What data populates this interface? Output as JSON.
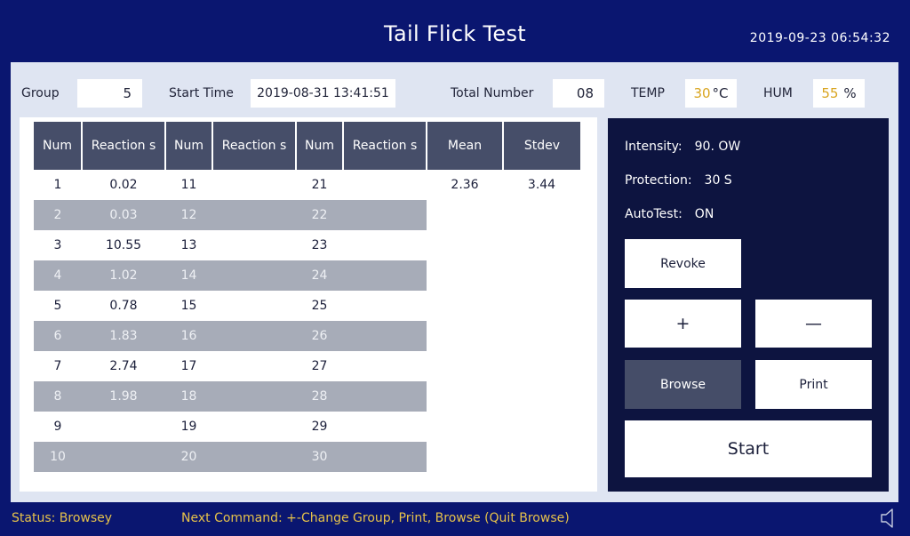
{
  "header": {
    "title": "Tail Flick Test",
    "datetime": "2019-09-23 06:54:32"
  },
  "info_bar": {
    "group_label": "Group",
    "group_value": "5",
    "start_time_label": "Start Time",
    "start_time_value": "2019-08-31 13:41:51",
    "total_number_label": "Total Number",
    "total_number_value": "08",
    "temp_label": "TEMP",
    "temp_value": "30",
    "temp_unit": "°C",
    "hum_label": "HUM",
    "hum_value": "55",
    "hum_unit": "%"
  },
  "table": {
    "headers": [
      "Num",
      "Reaction s",
      "Num",
      "Reaction s",
      "Num",
      "Reaction s",
      "Mean",
      "Stdev"
    ],
    "rows": [
      [
        "1",
        "0.02",
        "11",
        "",
        "21",
        "",
        "2.36",
        "3.44"
      ],
      [
        "2",
        "0.03",
        "12",
        "",
        "22",
        "",
        "",
        ""
      ],
      [
        "3",
        "10.55",
        "13",
        "",
        "23",
        "",
        "",
        ""
      ],
      [
        "4",
        "1.02",
        "14",
        "",
        "24",
        "",
        "",
        ""
      ],
      [
        "5",
        "0.78",
        "15",
        "",
        "25",
        "",
        "",
        ""
      ],
      [
        "6",
        "1.83",
        "16",
        "",
        "26",
        "",
        "",
        ""
      ],
      [
        "7",
        "2.74",
        "17",
        "",
        "27",
        "",
        "",
        ""
      ],
      [
        "8",
        "1.98",
        "18",
        "",
        "28",
        "",
        "",
        ""
      ],
      [
        "9",
        "",
        "19",
        "",
        "29",
        "",
        "",
        ""
      ],
      [
        "10",
        "",
        "20",
        "",
        "30",
        "",
        "",
        ""
      ]
    ]
  },
  "controls": {
    "intensity_label": "Intensity:",
    "intensity_value": "90. OW",
    "protection_label": "Protection:",
    "protection_value": "30 S",
    "autotest_label": "AutoTest:",
    "autotest_value": "ON",
    "revoke_label": "Revoke",
    "plus_label": "+",
    "minus_label": "—",
    "browse_label": "Browse",
    "print_label": "Print",
    "start_label": "Start"
  },
  "status_bar": {
    "status_text": "Status:  Browsey",
    "next_command_text": "Next Command:  +-Change Group, Print, Browse (Quit Browse)",
    "speaker_icon": "speaker-icon"
  },
  "colors": {
    "background": "#0a1670",
    "panel": "#dfe5f2",
    "header_cell": "#464e69",
    "alt_row": "#a7acb8",
    "control_panel": "#0d1440",
    "accent_gold": "#d9a520",
    "status_text": "#e6c24a"
  }
}
